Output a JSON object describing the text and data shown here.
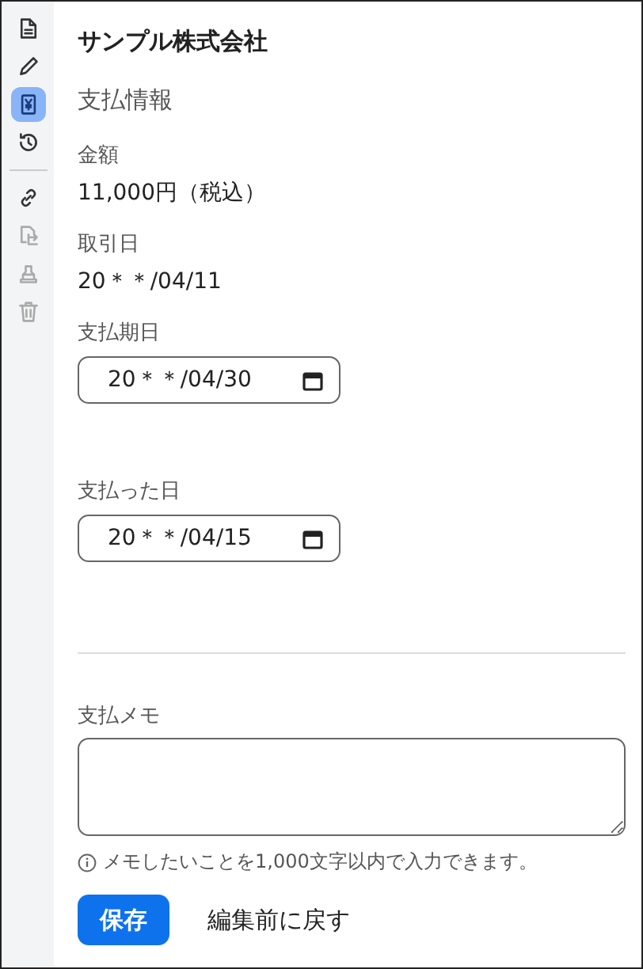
{
  "sidebar": {
    "items": [
      {
        "kind": "document",
        "selected": false,
        "disabled": false
      },
      {
        "kind": "pencil",
        "selected": false,
        "disabled": false
      },
      {
        "kind": "yen",
        "selected": true,
        "disabled": false
      },
      {
        "kind": "history",
        "selected": false,
        "disabled": false
      },
      {
        "kind": "divider"
      },
      {
        "kind": "link",
        "selected": false,
        "disabled": false
      },
      {
        "kind": "move",
        "selected": false,
        "disabled": true
      },
      {
        "kind": "stamp",
        "selected": false,
        "disabled": true
      },
      {
        "kind": "trash",
        "selected": false,
        "disabled": true
      }
    ]
  },
  "company": "サンプル株式会社",
  "section_title": "支払情報",
  "amount": {
    "label": "金額",
    "value": "11,000円（税込）"
  },
  "transaction_date": {
    "label": "取引日",
    "value": "20＊＊/04/11"
  },
  "due_date": {
    "label": "支払期日",
    "value": "20＊＊/04/30"
  },
  "paid_date": {
    "label": "支払った日",
    "value": "20＊＊/04/15"
  },
  "memo": {
    "label": "支払メモ",
    "hint": "メモしたいことを1,000文字以内で入力できます。"
  },
  "buttons": {
    "save": "保存",
    "revert": "編集前に戻す"
  }
}
